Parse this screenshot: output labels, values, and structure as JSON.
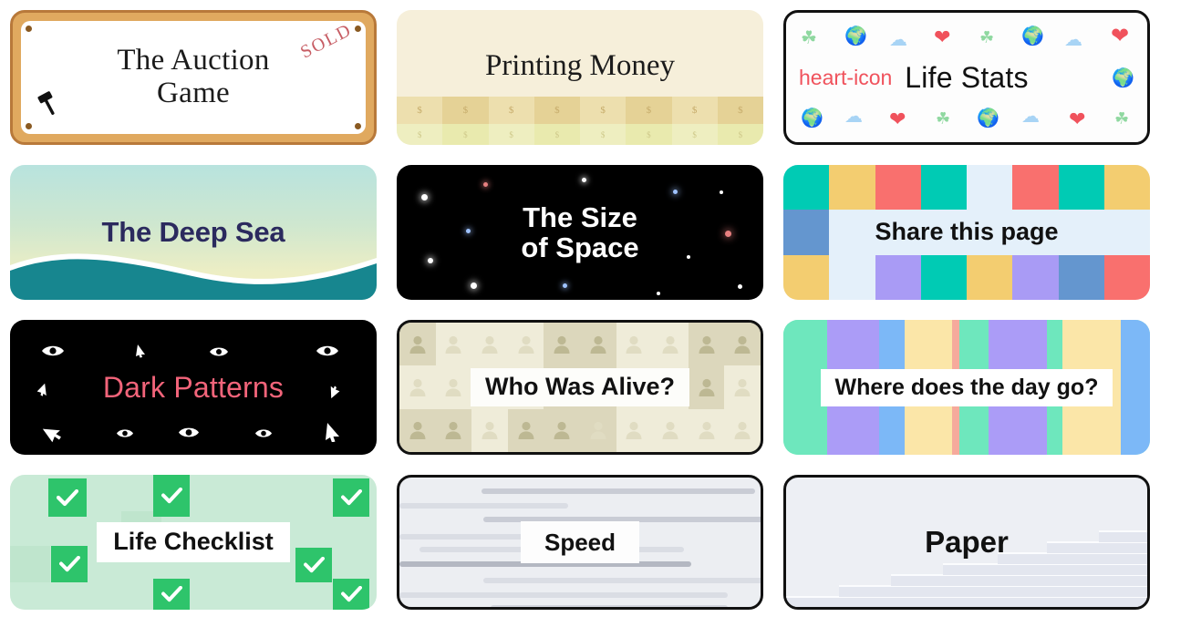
{
  "page": {
    "background": "#ffffff",
    "columns": 3,
    "rows": 4
  },
  "cards": [
    {
      "id": "auction-game",
      "title": "The Auction\nGame",
      "title_line1": "The Auction",
      "title_line2": "Game",
      "badge": "SOLD",
      "icon": "gavel-icon",
      "colors": {
        "frame": "#e0a95f",
        "frame_border": "#b8793a",
        "inner": "#ffffff",
        "badge": "#c75d64",
        "text": "#1b1b1b"
      }
    },
    {
      "id": "printing-money",
      "title": "Printing Money",
      "pattern": "money-bill-strip",
      "bill_symbol": "$",
      "bill_count": 8,
      "colors": {
        "bg": "#f6efda",
        "band_top": "#ecdfae",
        "band_top_alt": "#e5d296",
        "band_bottom": "#eeeec0",
        "band_bottom_alt": "#e8e9ad",
        "text": "#1b1b1b"
      }
    },
    {
      "id": "life-stats",
      "title": "Life Stats",
      "emojis_row1": [
        "clover-icon",
        "globe-icon",
        "cloud-icon",
        "heart-icon",
        "clover-icon",
        "globe-icon",
        "cloud-icon",
        "heart-icon"
      ],
      "emojis_row2_left": "heart-icon",
      "emojis_row2_right": "globe-icon",
      "emojis_row3": [
        "globe-icon",
        "cloud-icon",
        "heart-icon",
        "clover-icon",
        "globe-icon",
        "cloud-icon",
        "heart-icon",
        "clover-icon"
      ],
      "glyphs": {
        "clover-icon": "☘",
        "globe-icon": "🌍",
        "cloud-icon": "☁",
        "heart-icon": "❤"
      },
      "colors": {
        "bg": "#fdfdfd",
        "clover": "#8fd8a0",
        "globe": "#3cc6c0",
        "cloud": "#a8d4f5",
        "heart": "#f0525c",
        "text": "#111111"
      }
    },
    {
      "id": "the-deep-sea",
      "title": "The Deep Sea",
      "pattern": "ocean-wave",
      "colors": {
        "gradient_top": "#b8e3de",
        "gradient_bottom": "#f1eebd",
        "wave": "#17868f",
        "wave_crest": "#ffffff",
        "text": "#2b2a5e"
      }
    },
    {
      "id": "the-size-of-space",
      "title": "The Size\nof Space",
      "title_line1": "The Size",
      "title_line2": "of Space",
      "pattern": "starfield",
      "colors": {
        "bg": "#000000",
        "text": "#ffffff",
        "star_white": "#ffffff",
        "star_blue": "#8fb8ff",
        "star_red": "#e88080"
      }
    },
    {
      "id": "share-this-page",
      "title": "Share this page",
      "pattern": "color-block-grid",
      "grid_rows": [
        [
          "teal",
          "yellow",
          "red",
          "teal",
          "none",
          "red",
          "teal",
          "yellow"
        ],
        [
          "blue",
          "none",
          "none",
          "none",
          "none",
          "none",
          "none",
          "none"
        ],
        [
          "yellow",
          "none",
          "purple",
          "teal",
          "yellow",
          "purple",
          "blue",
          "red"
        ]
      ],
      "colors": {
        "bg": "#e4f0fa",
        "teal": "#00cbb4",
        "yellow": "#f3cd70",
        "red": "#f9706e",
        "blue": "#6496cf",
        "purple": "#a99bf5",
        "text": "#111111"
      }
    },
    {
      "id": "dark-patterns",
      "title": "Dark Patterns",
      "icons": [
        "eye-icon",
        "cursor-icon"
      ],
      "colors": {
        "bg": "#000000",
        "text": "#f2647a",
        "icon": "#ffffff"
      }
    },
    {
      "id": "who-was-alive",
      "title": "Who Was Alive?",
      "pattern": "person-icon-grid",
      "icon": "person-icon",
      "colors": {
        "bg": "#efecd9",
        "cell_dark": "#dcd7bc",
        "cell_mid": "#e6e2cc",
        "person_light": "#e0dcc2",
        "person_dark": "#bdb893",
        "label_bg": "#fdfdfa",
        "text": "#111111"
      }
    },
    {
      "id": "where-does-the-day-go",
      "title": "Where does the day go?",
      "pattern": "vertical-stripes",
      "stripes": [
        {
          "color": "#6ee7bd",
          "width": 12
        },
        {
          "color": "#ab9cf7",
          "width": 14
        },
        {
          "color": "#7cb8f7",
          "width": 7
        },
        {
          "color": "#fbe6a8",
          "width": 13
        },
        {
          "color": "#f6aa9c",
          "width": 2
        },
        {
          "color": "#6ee7bd",
          "width": 8
        },
        {
          "color": "#ab9cf7",
          "width": 16
        },
        {
          "color": "#6ee7bd",
          "width": 4
        },
        {
          "color": "#fbe6a8",
          "width": 16
        },
        {
          "color": "#7cb8f7",
          "width": 8
        }
      ],
      "colors": {
        "label_bg": "#ffffff",
        "text": "#111111"
      }
    },
    {
      "id": "life-checklist",
      "title": "Life Checklist",
      "pattern": "checkbox-grid",
      "icon": "check-icon",
      "colors": {
        "bg": "#c9ead6",
        "shade": "#bfe5cd",
        "check_box": "#2ec46b",
        "check_mark": "#ffffff",
        "label_bg": "#ffffff",
        "text": "#111111"
      }
    },
    {
      "id": "speed",
      "title": "Speed",
      "pattern": "speed-lines",
      "colors": {
        "bg": "#eceef2",
        "line_light": "#dadde4",
        "line_mid": "#c9ccd5",
        "line_dark": "#b4b8c2",
        "label_bg": "#fdfdfd",
        "text": "#111111"
      }
    },
    {
      "id": "paper",
      "title": "Paper",
      "pattern": "paper-stack-stairs",
      "colors": {
        "bg": "#edeff4",
        "sheet": "#e3e6ef",
        "sheet_edge": "#fbfcfe",
        "text": "#111111"
      }
    }
  ]
}
